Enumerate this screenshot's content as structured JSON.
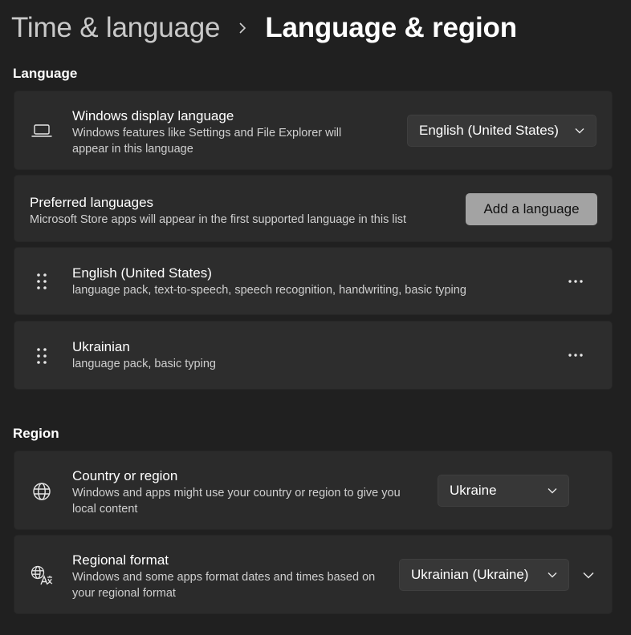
{
  "header": {
    "parent": "Time & language",
    "current": "Language & region"
  },
  "language_section": {
    "label": "Language",
    "display_language": {
      "icon": "laptop-icon",
      "title": "Windows display language",
      "description": "Windows features like Settings and File Explorer will appear in this language",
      "value": "English (United States)"
    },
    "preferred": {
      "title": "Preferred languages",
      "description": "Microsoft Store apps will appear in the first supported language in this list",
      "add_button": "Add a language"
    },
    "languages": [
      {
        "name": "English (United States)",
        "features": "language pack, text-to-speech, speech recognition, handwriting, basic typing"
      },
      {
        "name": "Ukrainian",
        "features": "language pack, basic typing"
      }
    ]
  },
  "region_section": {
    "label": "Region",
    "country": {
      "icon": "globe-icon",
      "title": "Country or region",
      "description": "Windows and apps might use your country or region to give you local content",
      "value": "Ukraine"
    },
    "format": {
      "icon": "regional-format-icon",
      "title": "Regional format",
      "description": "Windows and some apps format dates and times based on your regional format",
      "value": "Ukrainian (Ukraine)"
    }
  },
  "colors": {
    "background": "#202020",
    "card": "#2b2b2b",
    "accent_button": "#a3a3a3"
  }
}
